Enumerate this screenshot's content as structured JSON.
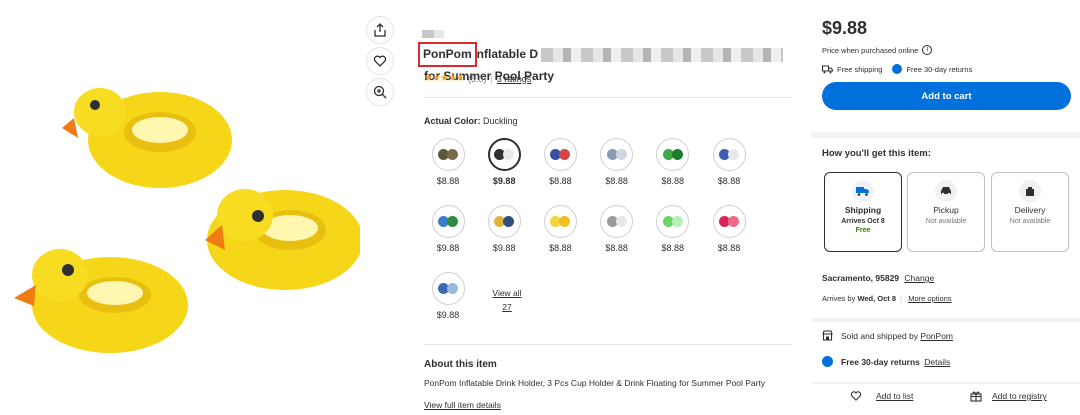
{
  "product": {
    "brand": "PonPom",
    "title_visible_part": "nflatable D",
    "title_line2": "for Summer Pool Party",
    "rating_value": "(5.0)",
    "ratings_link": "3 ratings",
    "actual_color_label": "Actual Color:",
    "actual_color_value": "Duckling",
    "swatches": [
      {
        "price": "$8.88",
        "colors": [
          "#5a5a3a",
          "#7a6a4a"
        ]
      },
      {
        "price": "$9.88",
        "colors": [
          "#2e2f32",
          "#e9e9e9"
        ],
        "selected": true
      },
      {
        "price": "$8.88",
        "colors": [
          "#3a4fa0",
          "#d64646"
        ]
      },
      {
        "price": "$8.88",
        "colors": [
          "#8a9bb8",
          "#cfd6e0"
        ]
      },
      {
        "price": "$8.88",
        "colors": [
          "#3ea84a",
          "#1f7a2c"
        ]
      },
      {
        "price": "$8.88",
        "colors": [
          "#3a5fb0",
          "#e8e8e8"
        ]
      },
      {
        "price": "$9.88",
        "colors": [
          "#3a7ec8",
          "#2e8a3e"
        ]
      },
      {
        "price": "$9.88",
        "colors": [
          "#e2b23a",
          "#2f4f7a"
        ]
      },
      {
        "price": "$8.88",
        "colors": [
          "#f4d23a",
          "#f0c020"
        ]
      },
      {
        "price": "$8.88",
        "colors": [
          "#9a9a9a",
          "#e8e8e8"
        ]
      },
      {
        "price": "$8.88",
        "colors": [
          "#6ad46a",
          "#b8eeb8"
        ]
      },
      {
        "price": "$8.88",
        "colors": [
          "#d6255a",
          "#f06a8a"
        ]
      },
      {
        "price": "$9.88",
        "colors": [
          "#3a6ab0",
          "#9ab8e0"
        ]
      }
    ],
    "view_all_line1": "View all",
    "view_all_line2": "27",
    "about_title": "About this item",
    "about_text": "PonPom Inflatable Drink Holder, 3 Pcs Cup Holder & Drink Floating for Summer Pool Party",
    "about_link": "View full item details"
  },
  "buy_box": {
    "price": "$9.88",
    "price_note": "Price when purchased online",
    "free_shipping": "Free shipping",
    "free_returns": "Free 30-day returns",
    "add_to_cart": "Add to cart",
    "how_title": "How you'll get this item:",
    "options": [
      {
        "name": "Shipping",
        "line1": "Arrives Oct 8",
        "line2": "Free",
        "icon": "truck-icon"
      },
      {
        "name": "Pickup",
        "line1": "Not available",
        "line2": "",
        "icon": "pickup-car-icon"
      },
      {
        "name": "Delivery",
        "line1": "Not available",
        "line2": "",
        "icon": "delivery-bag-icon"
      }
    ],
    "location": "Sacramento, 95829",
    "change": "Change",
    "arrives_prefix": "Arrives by ",
    "arrives_date": "Wed, Oct 8",
    "more_options": "More options",
    "sold_by_prefix": "Sold and shipped by ",
    "seller": "PonPom",
    "returns_label": "Free 30-day returns",
    "returns_details": "Details",
    "add_to_list": "Add to list",
    "add_to_registry": "Add to registry"
  },
  "colors": {
    "accent": "#0071dc",
    "highlight_box": "#d92b2b",
    "star": "#f5a623",
    "free_green": "#2a8703"
  }
}
